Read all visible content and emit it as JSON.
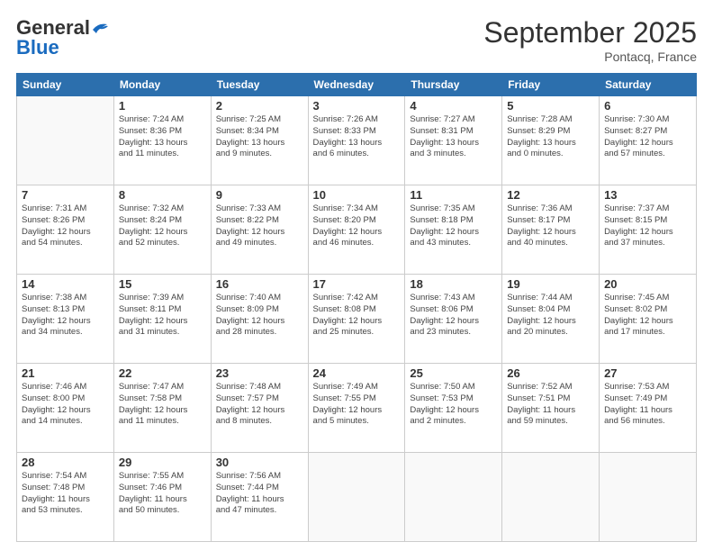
{
  "header": {
    "logo_general": "General",
    "logo_blue": "Blue",
    "title": "September 2025",
    "location": "Pontacq, France"
  },
  "days_of_week": [
    "Sunday",
    "Monday",
    "Tuesday",
    "Wednesday",
    "Thursday",
    "Friday",
    "Saturday"
  ],
  "weeks": [
    [
      {
        "day": "",
        "info": ""
      },
      {
        "day": "1",
        "info": "Sunrise: 7:24 AM\nSunset: 8:36 PM\nDaylight: 13 hours\nand 11 minutes."
      },
      {
        "day": "2",
        "info": "Sunrise: 7:25 AM\nSunset: 8:34 PM\nDaylight: 13 hours\nand 9 minutes."
      },
      {
        "day": "3",
        "info": "Sunrise: 7:26 AM\nSunset: 8:33 PM\nDaylight: 13 hours\nand 6 minutes."
      },
      {
        "day": "4",
        "info": "Sunrise: 7:27 AM\nSunset: 8:31 PM\nDaylight: 13 hours\nand 3 minutes."
      },
      {
        "day": "5",
        "info": "Sunrise: 7:28 AM\nSunset: 8:29 PM\nDaylight: 13 hours\nand 0 minutes."
      },
      {
        "day": "6",
        "info": "Sunrise: 7:30 AM\nSunset: 8:27 PM\nDaylight: 12 hours\nand 57 minutes."
      }
    ],
    [
      {
        "day": "7",
        "info": "Sunrise: 7:31 AM\nSunset: 8:26 PM\nDaylight: 12 hours\nand 54 minutes."
      },
      {
        "day": "8",
        "info": "Sunrise: 7:32 AM\nSunset: 8:24 PM\nDaylight: 12 hours\nand 52 minutes."
      },
      {
        "day": "9",
        "info": "Sunrise: 7:33 AM\nSunset: 8:22 PM\nDaylight: 12 hours\nand 49 minutes."
      },
      {
        "day": "10",
        "info": "Sunrise: 7:34 AM\nSunset: 8:20 PM\nDaylight: 12 hours\nand 46 minutes."
      },
      {
        "day": "11",
        "info": "Sunrise: 7:35 AM\nSunset: 8:18 PM\nDaylight: 12 hours\nand 43 minutes."
      },
      {
        "day": "12",
        "info": "Sunrise: 7:36 AM\nSunset: 8:17 PM\nDaylight: 12 hours\nand 40 minutes."
      },
      {
        "day": "13",
        "info": "Sunrise: 7:37 AM\nSunset: 8:15 PM\nDaylight: 12 hours\nand 37 minutes."
      }
    ],
    [
      {
        "day": "14",
        "info": "Sunrise: 7:38 AM\nSunset: 8:13 PM\nDaylight: 12 hours\nand 34 minutes."
      },
      {
        "day": "15",
        "info": "Sunrise: 7:39 AM\nSunset: 8:11 PM\nDaylight: 12 hours\nand 31 minutes."
      },
      {
        "day": "16",
        "info": "Sunrise: 7:40 AM\nSunset: 8:09 PM\nDaylight: 12 hours\nand 28 minutes."
      },
      {
        "day": "17",
        "info": "Sunrise: 7:42 AM\nSunset: 8:08 PM\nDaylight: 12 hours\nand 25 minutes."
      },
      {
        "day": "18",
        "info": "Sunrise: 7:43 AM\nSunset: 8:06 PM\nDaylight: 12 hours\nand 23 minutes."
      },
      {
        "day": "19",
        "info": "Sunrise: 7:44 AM\nSunset: 8:04 PM\nDaylight: 12 hours\nand 20 minutes."
      },
      {
        "day": "20",
        "info": "Sunrise: 7:45 AM\nSunset: 8:02 PM\nDaylight: 12 hours\nand 17 minutes."
      }
    ],
    [
      {
        "day": "21",
        "info": "Sunrise: 7:46 AM\nSunset: 8:00 PM\nDaylight: 12 hours\nand 14 minutes."
      },
      {
        "day": "22",
        "info": "Sunrise: 7:47 AM\nSunset: 7:58 PM\nDaylight: 12 hours\nand 11 minutes."
      },
      {
        "day": "23",
        "info": "Sunrise: 7:48 AM\nSunset: 7:57 PM\nDaylight: 12 hours\nand 8 minutes."
      },
      {
        "day": "24",
        "info": "Sunrise: 7:49 AM\nSunset: 7:55 PM\nDaylight: 12 hours\nand 5 minutes."
      },
      {
        "day": "25",
        "info": "Sunrise: 7:50 AM\nSunset: 7:53 PM\nDaylight: 12 hours\nand 2 minutes."
      },
      {
        "day": "26",
        "info": "Sunrise: 7:52 AM\nSunset: 7:51 PM\nDaylight: 11 hours\nand 59 minutes."
      },
      {
        "day": "27",
        "info": "Sunrise: 7:53 AM\nSunset: 7:49 PM\nDaylight: 11 hours\nand 56 minutes."
      }
    ],
    [
      {
        "day": "28",
        "info": "Sunrise: 7:54 AM\nSunset: 7:48 PM\nDaylight: 11 hours\nand 53 minutes."
      },
      {
        "day": "29",
        "info": "Sunrise: 7:55 AM\nSunset: 7:46 PM\nDaylight: 11 hours\nand 50 minutes."
      },
      {
        "day": "30",
        "info": "Sunrise: 7:56 AM\nSunset: 7:44 PM\nDaylight: 11 hours\nand 47 minutes."
      },
      {
        "day": "",
        "info": ""
      },
      {
        "day": "",
        "info": ""
      },
      {
        "day": "",
        "info": ""
      },
      {
        "day": "",
        "info": ""
      }
    ]
  ]
}
